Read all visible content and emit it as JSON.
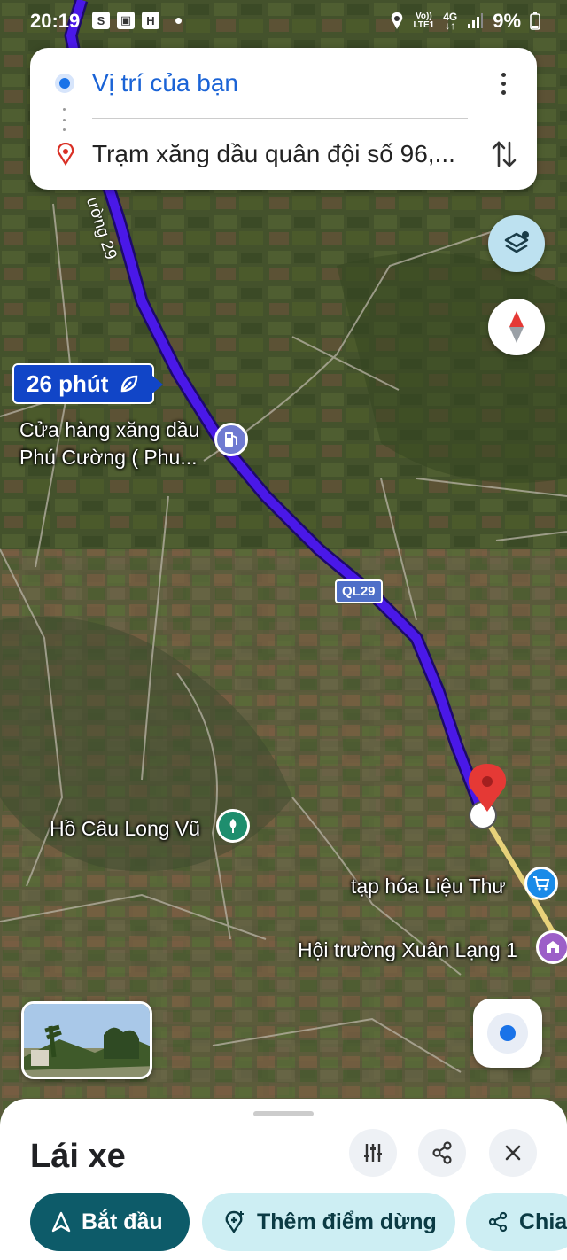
{
  "status_bar": {
    "time": "20:19",
    "left_icons": [
      "shopee-icon",
      "gallery-icon",
      "app-icon"
    ],
    "network_top": "Vo))",
    "network_bottom": "LTE1",
    "network_type": "4G",
    "battery": "9%"
  },
  "route": {
    "origin": "Vị trí của bạn",
    "destination": "Trạm xăng dầu quân đội số 96,..."
  },
  "map": {
    "eta": "26 phút",
    "road_name": "ường 29",
    "road_shield": "QL29",
    "pois": [
      {
        "name_line1": "Cửa hàng xăng dầu",
        "name_line2": "Phú Cường ( Phu...",
        "icon": "gas-station-icon",
        "color": "#6f7ad1"
      },
      {
        "name_line1": "Hồ Câu Long Vũ",
        "icon": "park-icon",
        "color": "#1e8e6e"
      },
      {
        "name_line1": "tạp hóa Liệu Thư",
        "icon": "shopping-cart-icon",
        "color": "#1a8be8"
      },
      {
        "name_line1": "Hội trường Xuân Lạng 1",
        "icon": "building-icon",
        "color": "#9c5fc8"
      }
    ],
    "route_color": "#4a18e8"
  },
  "sheet": {
    "title": "Lái xe",
    "actions": {
      "start": "Bắt đầu",
      "add_stop": "Thêm điểm dừng",
      "share": "Chia"
    }
  }
}
